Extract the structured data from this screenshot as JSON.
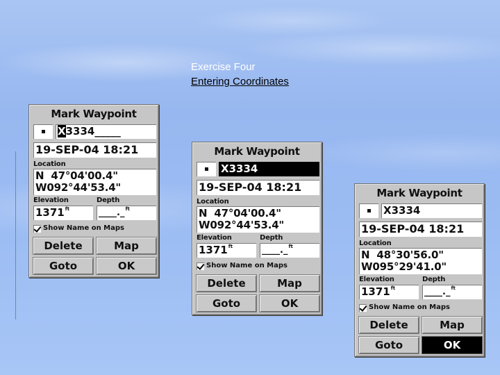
{
  "slide": {
    "title": "Exercise Four",
    "subtitle": "Entering Coordinates"
  },
  "screens": [
    {
      "title": "Mark Waypoint",
      "symbol_icon": "waypoint-dot-icon",
      "name_cursor_char": "X",
      "name_rest": "3334_____",
      "name_full": "X3334",
      "name_field_selected": false,
      "date": "19-SEP-04 18:21",
      "location_label": "Location",
      "lat": "N  47°04'00.4\"",
      "lon": "W092°44'53.4\"",
      "elevation_label": "Elevation",
      "elevation": "1371",
      "elevation_unit": "ft",
      "depth_label": "Depth",
      "depth": "____._",
      "depth_unit": "ft",
      "show_name_label": "Show Name on Maps",
      "show_name_checked": true,
      "buttons": {
        "delete": "Delete",
        "map": "Map",
        "goto": "Goto",
        "ok": "OK"
      },
      "ok_selected": false
    },
    {
      "title": "Mark Waypoint",
      "symbol_icon": "waypoint-dot-icon",
      "name_full": "X3334",
      "name_field_selected": true,
      "date": "19-SEP-04 18:21",
      "location_label": "Location",
      "lat": "N  47°04'00.4\"",
      "lon": "W092°44'53.4\"",
      "elevation_label": "Elevation",
      "elevation": "1371",
      "elevation_unit": "ft",
      "depth_label": "Depth",
      "depth": "____._",
      "depth_unit": "ft",
      "show_name_label": "Show Name on Maps",
      "show_name_checked": true,
      "buttons": {
        "delete": "Delete",
        "map": "Map",
        "goto": "Goto",
        "ok": "OK"
      },
      "ok_selected": false
    },
    {
      "title": "Mark Waypoint",
      "symbol_icon": "waypoint-dot-icon",
      "name_full": "X3334",
      "name_field_selected": false,
      "date": "19-SEP-04 18:21",
      "location_label": "Location",
      "lat": "N  48°30'56.0\"",
      "lon": "W095°29'41.0\"",
      "elevation_label": "Elevation",
      "elevation": "1371",
      "elevation_unit": "ft",
      "depth_label": "Depth",
      "depth": "____._",
      "depth_unit": "ft",
      "show_name_label": "Show Name on Maps",
      "show_name_checked": true,
      "buttons": {
        "delete": "Delete",
        "map": "Map",
        "goto": "Goto",
        "ok": "OK"
      },
      "ok_selected": true
    }
  ]
}
